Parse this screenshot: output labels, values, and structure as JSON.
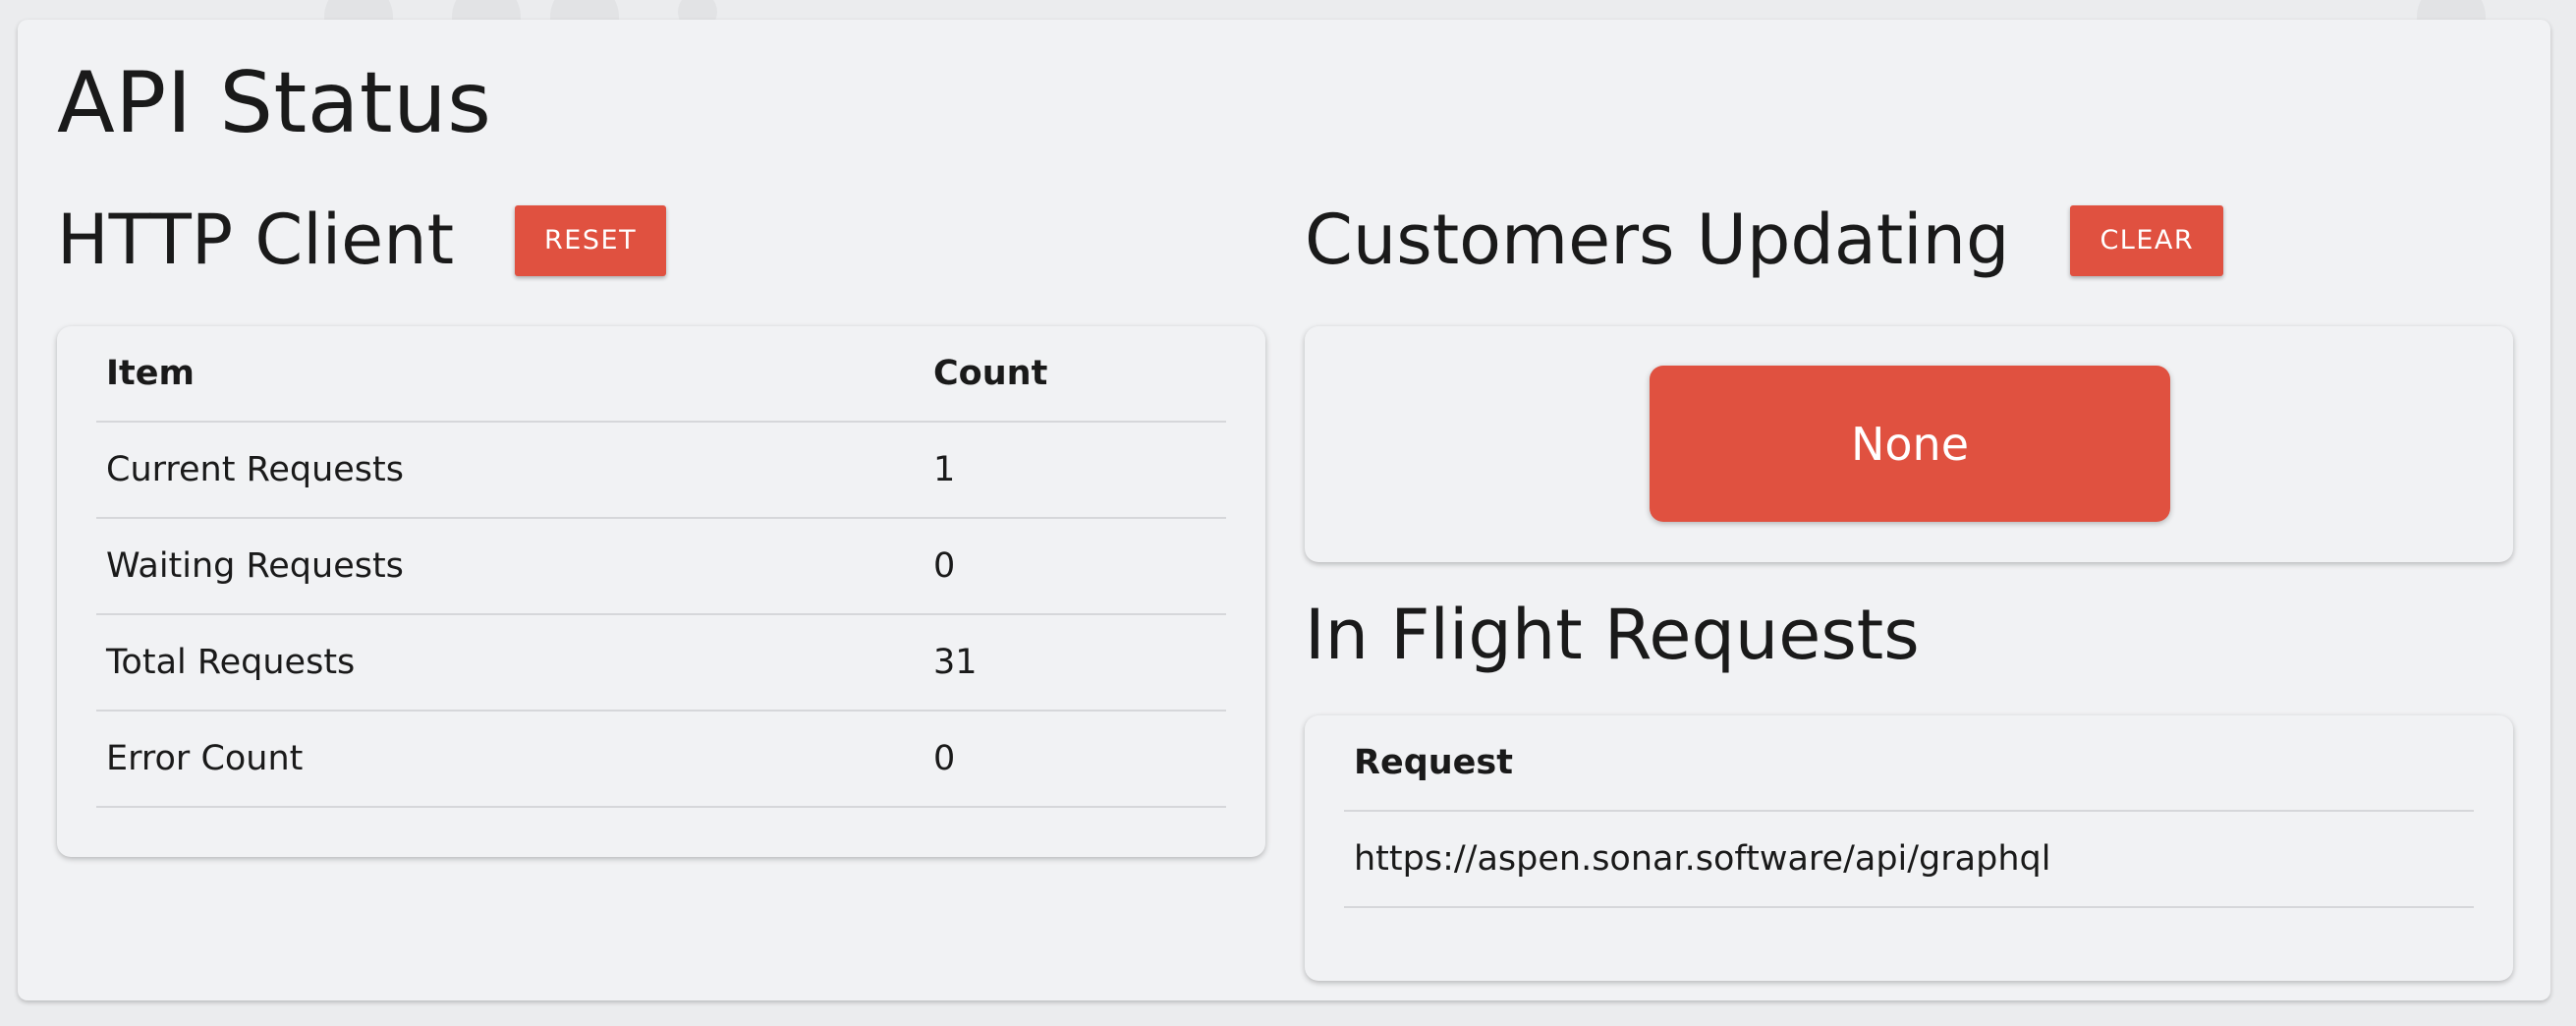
{
  "page": {
    "title": "API Status"
  },
  "http_client": {
    "heading": "HTTP Client",
    "reset_label": "RESET",
    "table": {
      "headers": [
        "Item",
        "Count"
      ],
      "rows": [
        {
          "item": "Current Requests",
          "count": "1"
        },
        {
          "item": "Waiting Requests",
          "count": "0"
        },
        {
          "item": "Total Requests",
          "count": "31"
        },
        {
          "item": "Error Count",
          "count": "0"
        }
      ]
    }
  },
  "customers_updating": {
    "heading": "Customers Updating",
    "clear_label": "CLEAR",
    "status_label": "None"
  },
  "in_flight": {
    "heading": "In Flight Requests",
    "table": {
      "headers": [
        "Request"
      ],
      "rows": [
        {
          "request": "https://aspen.sonar.software/api/graphql"
        }
      ]
    }
  },
  "colors": {
    "accent": "#e05140",
    "panel_bg": "#f1f2f4",
    "page_bg": "#ebecee"
  }
}
